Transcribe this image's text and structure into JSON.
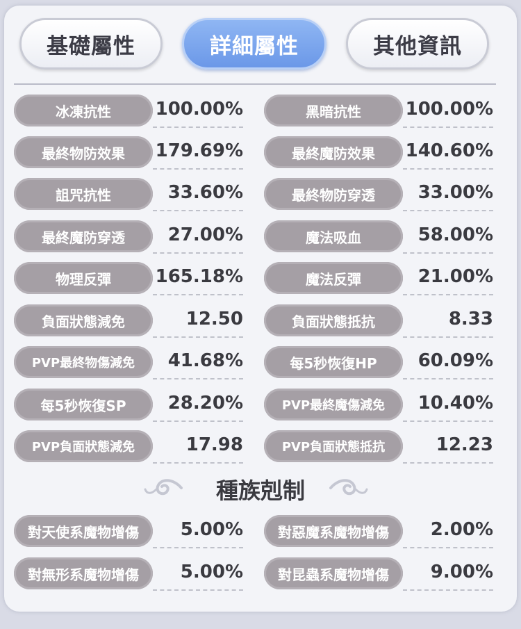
{
  "tabs": [
    {
      "label": "基礎屬性",
      "active": false
    },
    {
      "label": "詳細屬性",
      "active": true
    },
    {
      "label": "其他資訊",
      "active": false
    }
  ],
  "stats": {
    "left": [
      {
        "label": "冰凍抗性",
        "value": "100.00%"
      },
      {
        "label": "最終物防效果",
        "value": "179.69%"
      },
      {
        "label": "詛咒抗性",
        "value": "33.60%"
      },
      {
        "label": "最終魔防穿透",
        "value": "27.00%"
      },
      {
        "label": "物理反彈",
        "value": "165.18%"
      },
      {
        "label": "負面狀態減免",
        "value": "12.50"
      },
      {
        "label": "PVP最終物傷減免",
        "value": "41.68%"
      },
      {
        "label": "每5秒恢復SP",
        "value": "28.20%"
      },
      {
        "label": "PVP負面狀態減免",
        "value": "17.98"
      }
    ],
    "right": [
      {
        "label": "黑暗抗性",
        "value": "100.00%"
      },
      {
        "label": "最終魔防效果",
        "value": "140.60%"
      },
      {
        "label": "最終物防穿透",
        "value": "33.00%"
      },
      {
        "label": "魔法吸血",
        "value": "58.00%"
      },
      {
        "label": "魔法反彈",
        "value": "21.00%"
      },
      {
        "label": "負面狀態抵抗",
        "value": "8.33"
      },
      {
        "label": "每5秒恢復HP",
        "value": "60.09%"
      },
      {
        "label": "PVP最終魔傷減免",
        "value": "10.40%"
      },
      {
        "label": "PVP負面狀態抵抗",
        "value": "12.23"
      }
    ]
  },
  "race_section": {
    "title": "種族剋制",
    "left": [
      {
        "label": "對天使系魔物增傷",
        "value": "5.00%"
      },
      {
        "label": "對無形系魔物增傷",
        "value": "5.00%"
      }
    ],
    "right": [
      {
        "label": "對惡魔系魔物增傷",
        "value": "2.00%"
      },
      {
        "label": "對昆蟲系魔物增傷",
        "value": "9.00%"
      }
    ]
  },
  "colors": {
    "pill": "#a59fa5",
    "active_tab": "#7aa6ee",
    "panel": "#f3f4f8"
  }
}
